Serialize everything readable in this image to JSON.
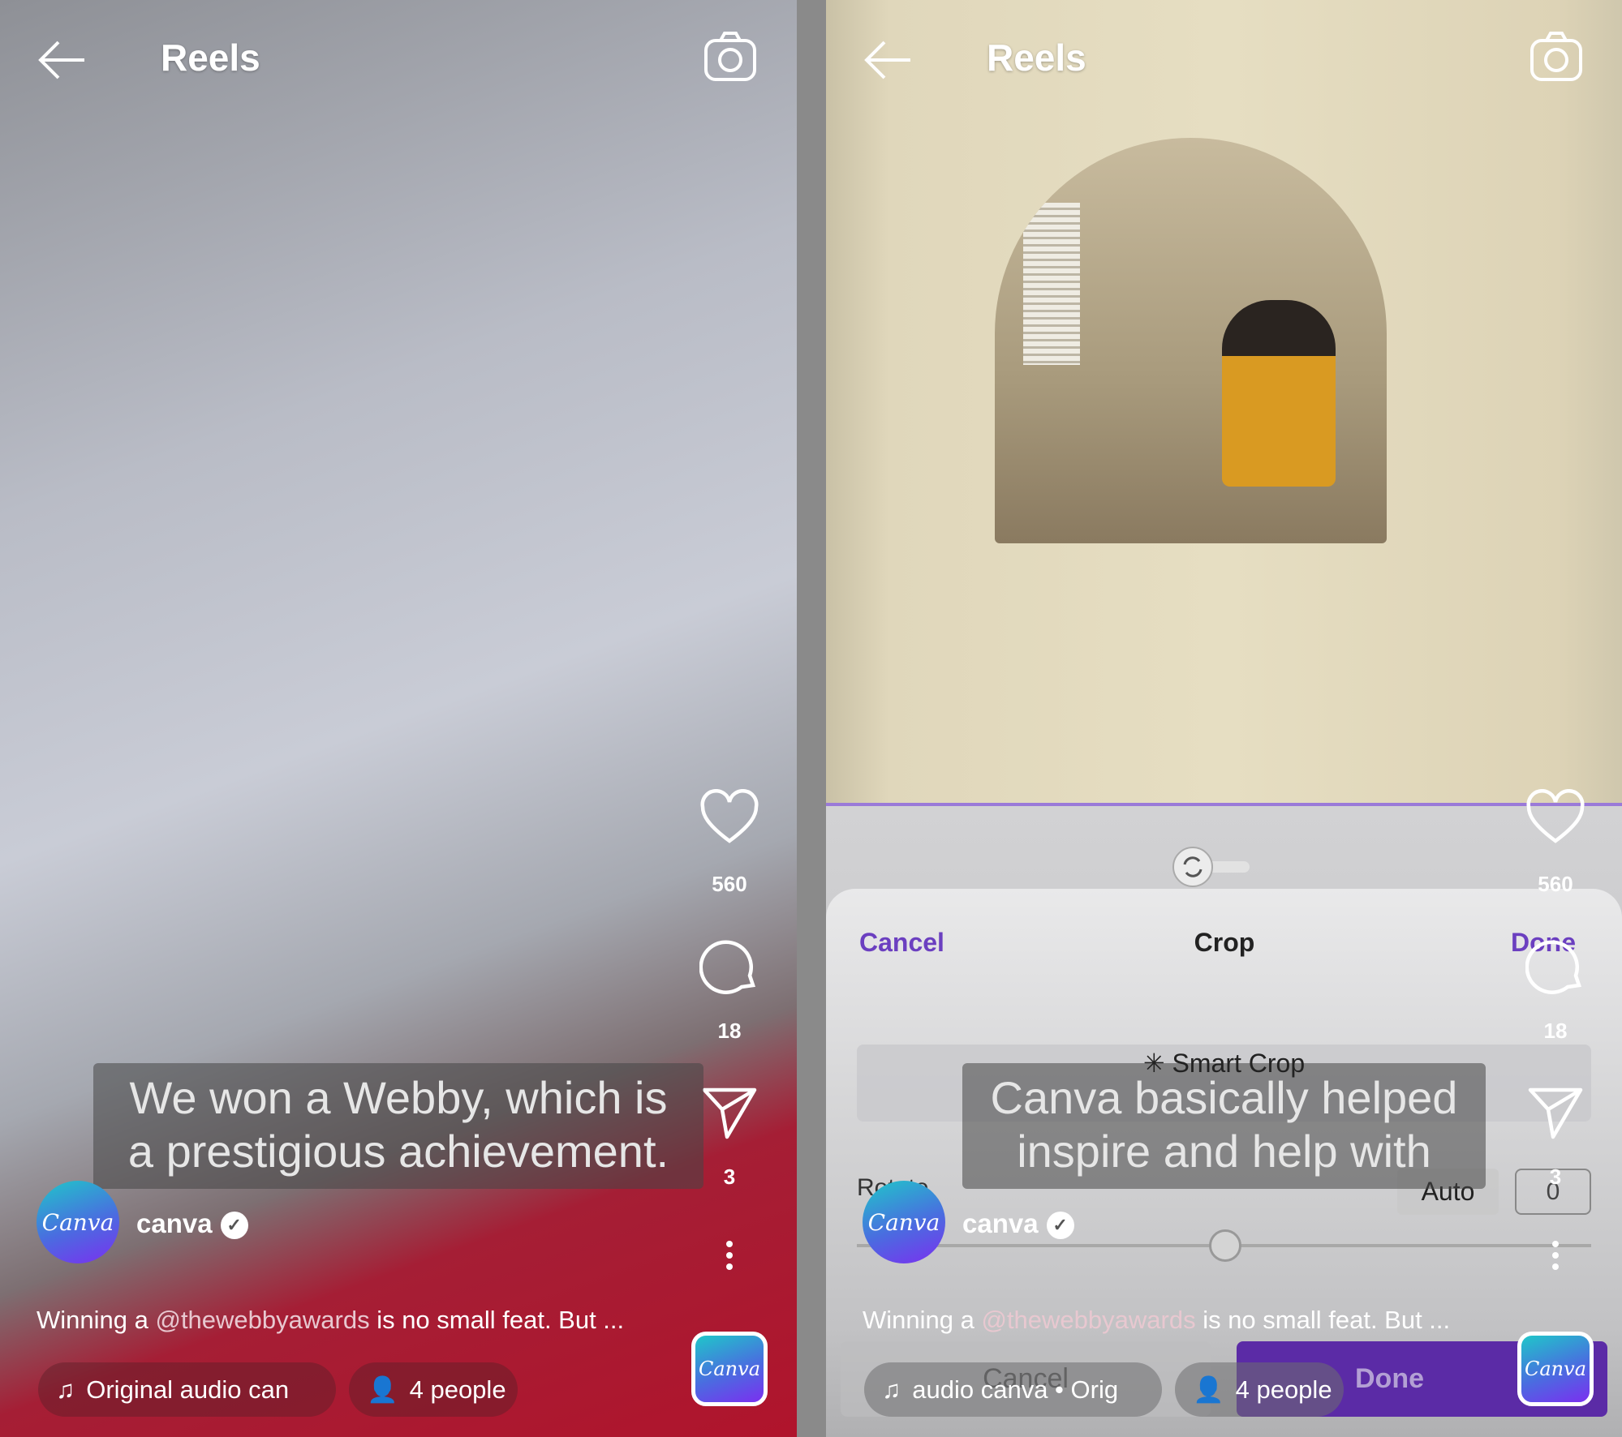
{
  "header": {
    "title": "Reels",
    "icons": [
      "arrow-left-icon",
      "camera-icon"
    ]
  },
  "left_reel": {
    "likes": "560",
    "comments": "18",
    "shares": "3",
    "caption_overlay": [
      "We won a Webby, which is",
      "a prestigious achievement."
    ],
    "avatar_text": "Canva",
    "username": "canva",
    "description_prefix": "Winning a ",
    "description_mention": "@thewebbyawards",
    "description_suffix": " is no small feat. But ...",
    "audio_chip": "Original audio   can",
    "people_chip": "4 people",
    "audio_thumb_text": "Canva"
  },
  "right_reel": {
    "likes": "560",
    "comments": "18",
    "shares": "3",
    "caption_overlay": [
      "Canva basically helped",
      "inspire and help with"
    ],
    "avatar_text": "Canva",
    "username": "canva",
    "description_prefix": "Winning a ",
    "description_mention": "@thewebbyawards",
    "description_suffix": " is no small feat. But ...",
    "audio_chip": "audio   canva • Orig",
    "people_chip": "4 people",
    "audio_thumb_text": "Canva",
    "crop_sheet": {
      "cancel": "Cancel",
      "title": "Crop",
      "done": "Done",
      "smart_crop": "Smart Crop",
      "rotate_label": "Rotate",
      "auto": "Auto",
      "rotate_value": "0",
      "bottom_cancel": "Cancel",
      "bottom_done": "Done"
    }
  },
  "colors": {
    "accent_purple": "#5b2ba6",
    "link_purple": "#6b3fc0",
    "mention": "#e8c8d0"
  }
}
